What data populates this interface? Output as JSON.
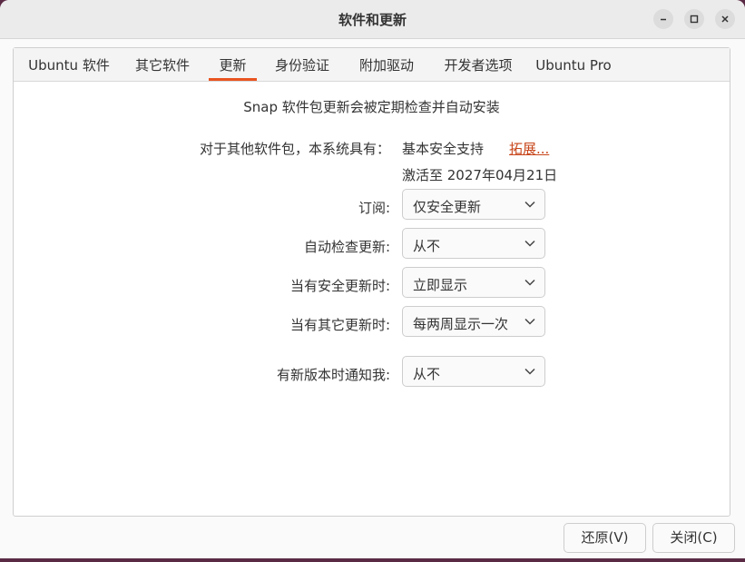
{
  "window": {
    "title": "软件和更新"
  },
  "tabs": [
    {
      "label": "Ubuntu 软件"
    },
    {
      "label": "其它软件"
    },
    {
      "label": "更新",
      "active": true
    },
    {
      "label": "身份验证"
    },
    {
      "label": "附加驱动"
    },
    {
      "label": "开发者选项"
    },
    {
      "label": "Ubuntu Pro"
    }
  ],
  "updates": {
    "snap_note": "Snap 软件包更新会被定期检查并自动安装",
    "other_packages_label": "对于其他软件包，本系统具有：",
    "support_level": "基本安全支持",
    "extend_link": "拓展...",
    "active_until": "激活至 2027年04月21日",
    "subscribe_label": "订阅:",
    "subscribe_value": "仅安全更新",
    "auto_check_label": "自动检查更新:",
    "auto_check_value": "从不",
    "security_updates_label": "当有安全更新时:",
    "security_updates_value": "立即显示",
    "other_updates_label": "当有其它更新时:",
    "other_updates_value": "每两周显示一次",
    "new_version_label": "有新版本时通知我:",
    "new_version_value": "从不"
  },
  "footer": {
    "revert_label": "还原(V)",
    "close_label": "关闭(C)"
  },
  "colors": {
    "accent": "#e95420",
    "link": "#c7461a"
  },
  "icons": [
    "minimize-icon",
    "maximize-icon",
    "close-icon",
    "chevron-down-icon"
  ]
}
